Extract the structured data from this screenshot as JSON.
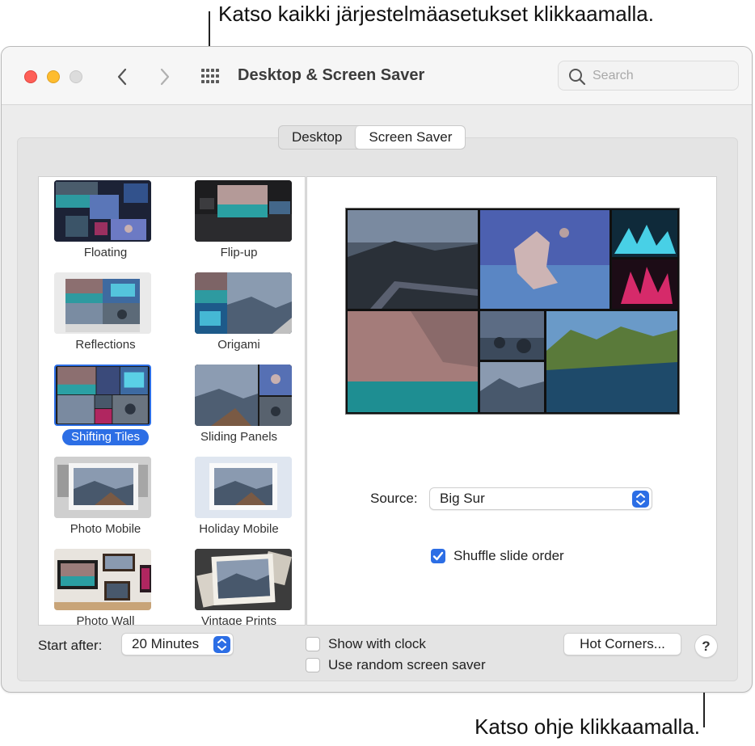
{
  "callouts": {
    "top": "Katso kaikki järjestelmäasetukset klikkaamalla.",
    "bottom": "Katso ohje klikkaamalla."
  },
  "window": {
    "title": "Desktop & Screen Saver",
    "search_placeholder": "Search",
    "icons": {
      "back": "chevron-left-icon",
      "forward": "chevron-right-icon",
      "all_prefs": "grid-icon",
      "search": "magnifier-icon"
    }
  },
  "tabs": [
    {
      "label": "Desktop",
      "active": false
    },
    {
      "label": "Screen Saver",
      "active": true
    }
  ],
  "savers": [
    {
      "label": "Floating",
      "selected": false
    },
    {
      "label": "Flip-up",
      "selected": false
    },
    {
      "label": "Reflections",
      "selected": false
    },
    {
      "label": "Origami",
      "selected": false
    },
    {
      "label": "Shifting Tiles",
      "selected": true
    },
    {
      "label": "Sliding Panels",
      "selected": false
    },
    {
      "label": "Photo Mobile",
      "selected": false
    },
    {
      "label": "Holiday Mobile",
      "selected": false
    },
    {
      "label": "Photo Wall",
      "selected": false
    },
    {
      "label": "Vintage Prints",
      "selected": false
    }
  ],
  "options": {
    "source_label": "Source:",
    "source_value": "Big Sur",
    "shuffle_label": "Shuffle slide order",
    "shuffle_checked": true
  },
  "footer": {
    "start_after_label": "Start after:",
    "start_after_value": "20 Minutes",
    "show_clock_label": "Show with clock",
    "show_clock_checked": false,
    "random_label": "Use random screen saver",
    "random_checked": false,
    "hot_corners_label": "Hot Corners...",
    "help_label": "?"
  },
  "colors": {
    "accent": "#2c6ee5",
    "close": "#fe5f57",
    "minimize": "#febc2e",
    "zoom_disabled": "#dcdcdc"
  }
}
